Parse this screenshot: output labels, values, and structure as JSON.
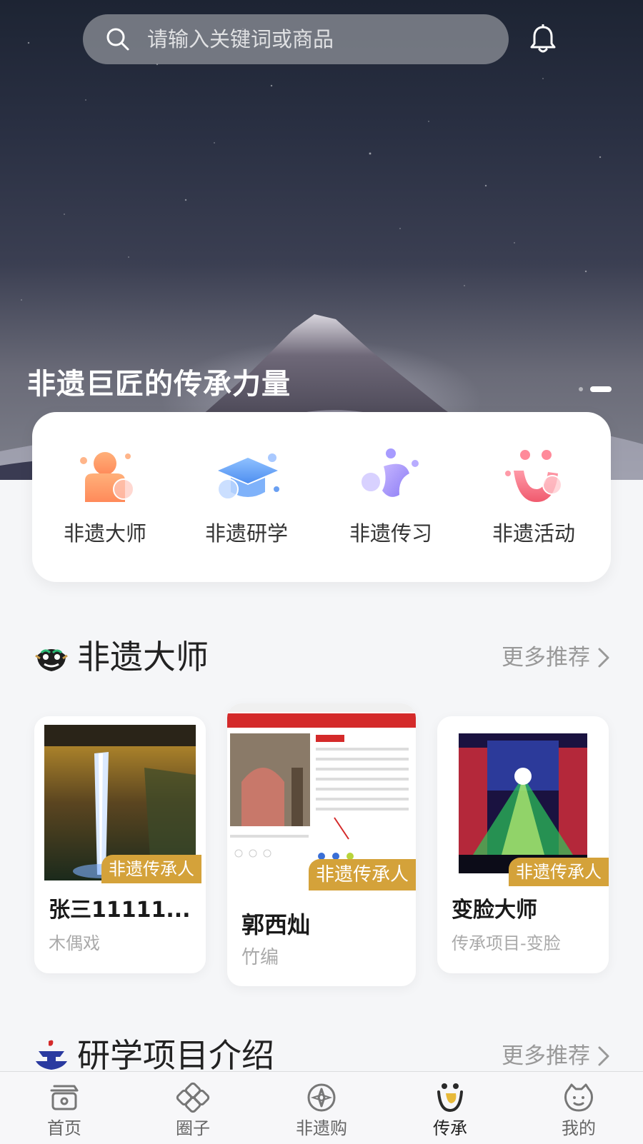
{
  "search": {
    "placeholder": "请输入关键词或商品"
  },
  "hero": {
    "title": "非遗巨匠的传承力量"
  },
  "quick_nav": [
    {
      "label": "非遗大师",
      "icon": "master-icon"
    },
    {
      "label": "非遗研学",
      "icon": "graduation-cap-icon"
    },
    {
      "label": "非遗传习",
      "icon": "practice-icon"
    },
    {
      "label": "非遗活动",
      "icon": "activity-icon"
    }
  ],
  "masters_section": {
    "title": "非遗大师",
    "more_label": "更多推荐",
    "cards": [
      {
        "badge": "非遗传承人",
        "name": "张三11111...",
        "sub": "木偶戏"
      },
      {
        "badge": "非遗传承人",
        "name": "郭西灿",
        "sub": "竹编"
      },
      {
        "badge": "非遗传承人",
        "name": "变脸大师",
        "sub": "传承项目-变脸"
      }
    ]
  },
  "study_section": {
    "title": "研学项目介绍",
    "more_label": "更多推荐"
  },
  "tabbar": [
    {
      "label": "首页",
      "icon": "home-icon"
    },
    {
      "label": "圈子",
      "icon": "circle-knot-icon"
    },
    {
      "label": "非遗购",
      "icon": "compass-icon"
    },
    {
      "label": "传承",
      "icon": "inherit-icon",
      "active": true
    },
    {
      "label": "我的",
      "icon": "profile-icon"
    }
  ],
  "colors": {
    "badge": "#d4a23a",
    "background": "#f5f6f8",
    "active_tab": "#222222"
  }
}
